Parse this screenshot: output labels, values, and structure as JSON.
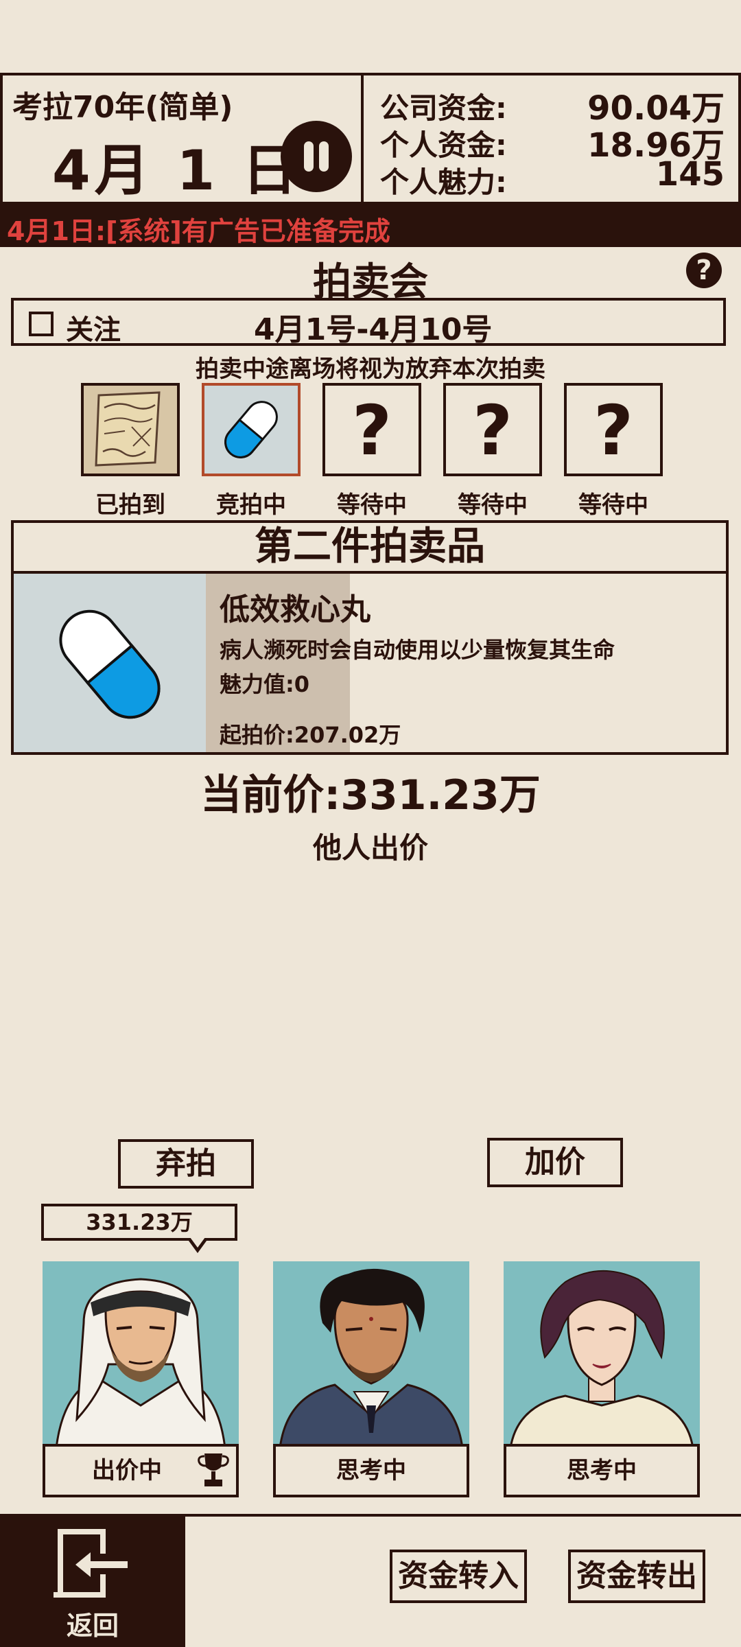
{
  "header": {
    "year_label": "考拉70年(简单)",
    "date": "4月 1 日",
    "company_funds_label": "公司资金:",
    "company_funds_value": "90.04万",
    "personal_funds_label": "个人资金:",
    "personal_funds_value": "18.96万",
    "charm_label": "个人魅力:",
    "charm_value": "145"
  },
  "news": {
    "text": "4月1日:[系统]有广告已准备完成"
  },
  "auction": {
    "title": "拍卖会",
    "help_icon": "?",
    "follow_label": "关注",
    "period": "4月1号-4月10号",
    "notice": "拍卖中途离场将视为放弃本次拍卖",
    "slots": [
      {
        "label": "已拍到",
        "icon": "scroll-icon"
      },
      {
        "label": "竞拍中",
        "icon": "capsule-icon"
      },
      {
        "label": "等待中",
        "icon": "?"
      },
      {
        "label": "等待中",
        "icon": "?"
      },
      {
        "label": "等待中",
        "icon": "?"
      }
    ],
    "item_heading": "第二件拍卖品",
    "item": {
      "name": "低效救心丸",
      "description": "病人濒死时会自动使用以少量恢复其生命",
      "charm": "魅力值:0",
      "start_price": "起拍价:207.02万"
    },
    "current_price": "当前价:331.23万",
    "status": "他人出价",
    "give_up_label": "弃拍",
    "raise_label": "加价"
  },
  "bidders": {
    "bubble": "331.23万",
    "list": [
      {
        "status": "出价中"
      },
      {
        "status": "思考中"
      },
      {
        "status": "思考中"
      }
    ]
  },
  "footer": {
    "back_label": "返回",
    "deposit_label": "资金转入",
    "withdraw_label": "资金转出"
  },
  "colors": {
    "background": "#eee6d8",
    "dark": "#2a120c",
    "news_text": "#e0423e",
    "portrait_bg": "#7fbdbf",
    "capsule_blue": "#0d9be3"
  }
}
